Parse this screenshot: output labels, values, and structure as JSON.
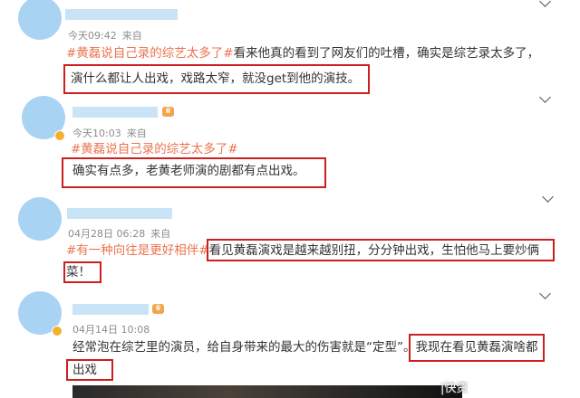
{
  "comments": [
    {
      "time": "今天09:42",
      "source": "来自",
      "topic": "#黄磊说自己录的综艺太多了#",
      "line1_rest": "看来他真的看到了网友们的吐槽，确实是综艺录太多了，",
      "line2": "演什么都让人出戏，戏路太窄，就没get到他的演技。"
    },
    {
      "time": "今天10:03",
      "source": "来自",
      "topic": "#黄磊说自己录的综艺太多了#",
      "line2": "确实有点多，老黄老师演的剧都有点出戏。"
    },
    {
      "time": "04月28日 06:28",
      "source": "来自",
      "topic": "#有一种向往是更好相伴#",
      "line1_rest": "看见黄磊演戏是越来越别扭，分分钟出戏，生怕他马上要炒俩",
      "line2": "菜！"
    },
    {
      "time": "04月14日 10:08",
      "line1_a": "经常泡在综艺里的演员，给自身带来的最大的伤害就是“定型”。",
      "line1_b": "我现在看见黄磊演啥都",
      "line2": "出戏"
    }
  ],
  "watermark": "|快资"
}
